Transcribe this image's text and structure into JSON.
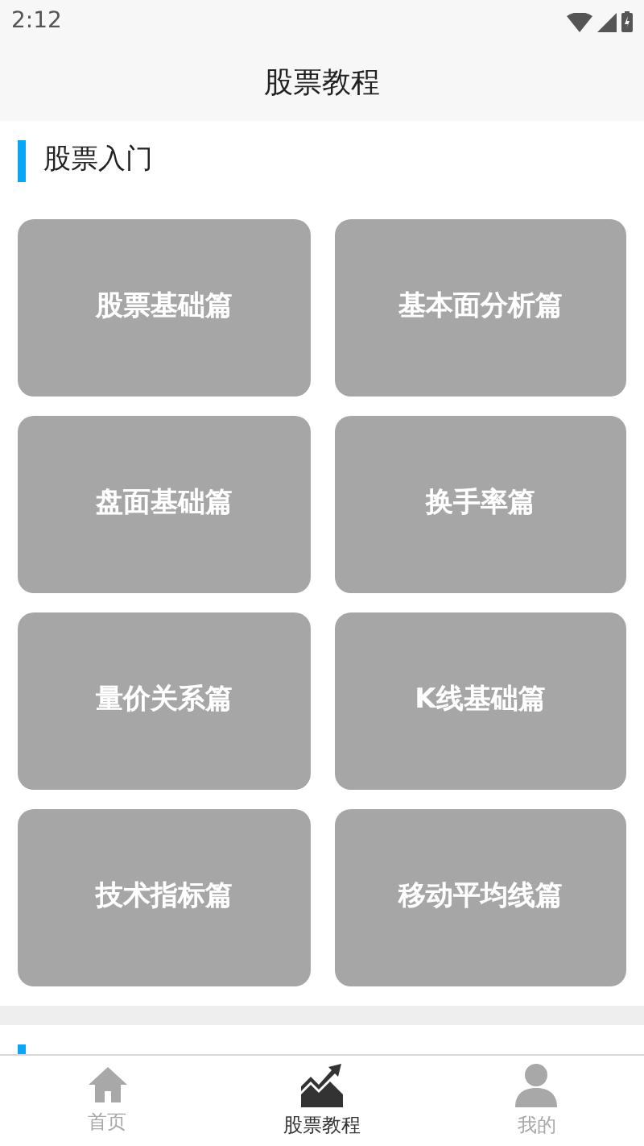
{
  "status_bar": {
    "time": "2:12"
  },
  "header": {
    "title": "股票教程"
  },
  "sections": [
    {
      "title": "股票入门",
      "tiles": [
        "股票基础篇",
        "基本面分析篇",
        "盘面基础篇",
        "换手率篇",
        "量价关系篇",
        "K线基础篇",
        "技术指标篇",
        "移动平均线篇"
      ]
    }
  ],
  "tab_bar": [
    {
      "label": "首页",
      "kind": "home",
      "selected": false
    },
    {
      "label": "股票教程",
      "kind": "chart",
      "selected": true
    },
    {
      "label": "我的",
      "kind": "user",
      "selected": false
    }
  ]
}
